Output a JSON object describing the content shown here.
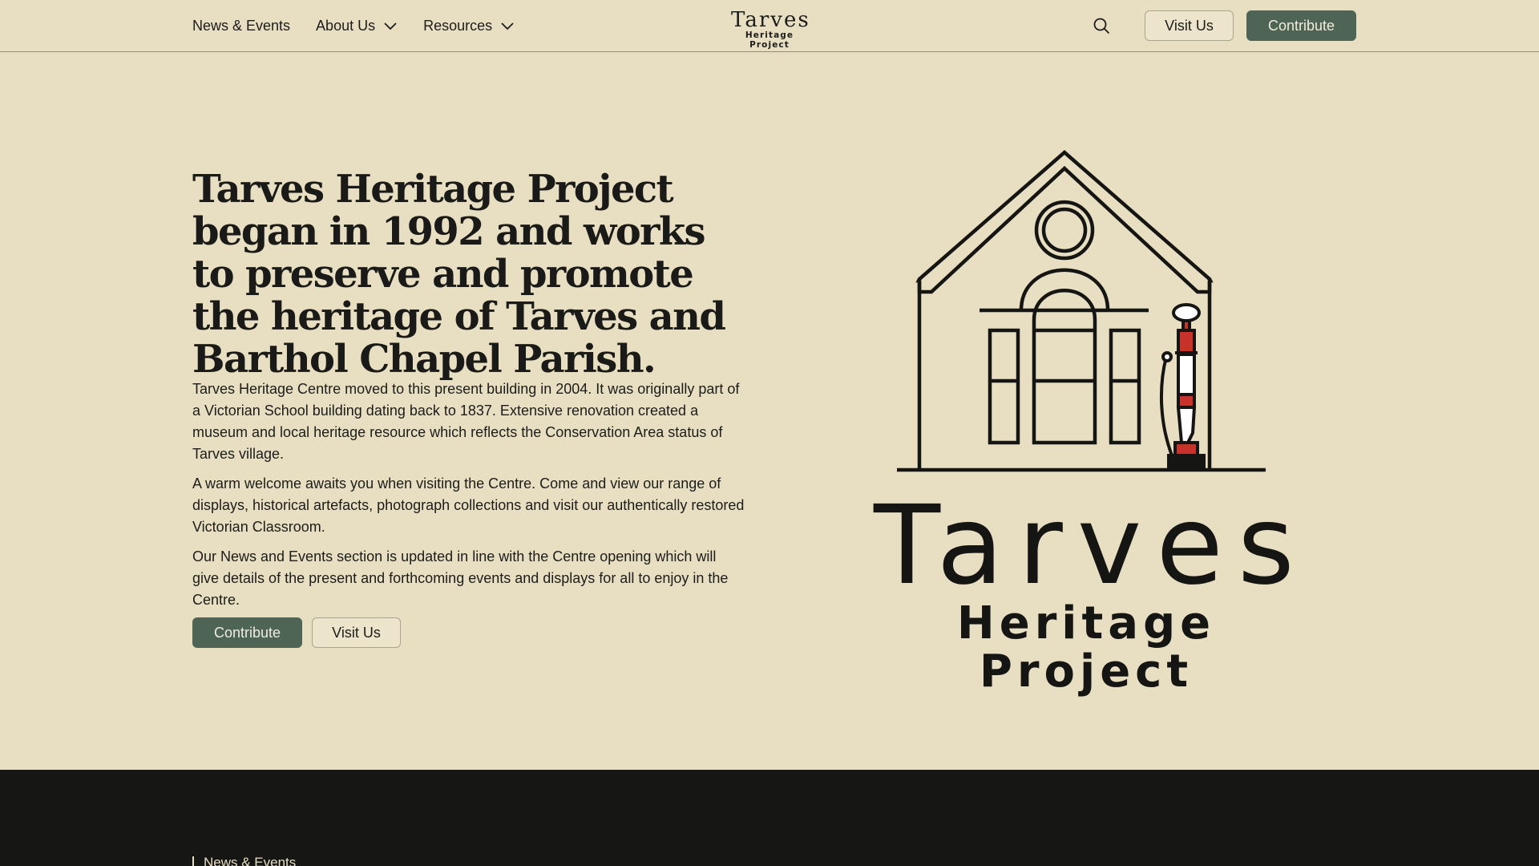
{
  "header": {
    "nav": [
      {
        "label": "News & Events",
        "has_dropdown": false
      },
      {
        "label": "About Us",
        "has_dropdown": true
      },
      {
        "label": "Resources",
        "has_dropdown": true
      }
    ],
    "logo": {
      "name": "Tarves",
      "subtitle": "Heritage Project"
    },
    "search_icon": "search-icon",
    "visit_label": "Visit Us",
    "contribute_label": "Contribute"
  },
  "hero": {
    "title": "Tarves Heritage Project began in 1992 and works to preserve and promote the heritage of Tarves and Barthol Chapel Parish.",
    "paragraphs": [
      "Tarves Heritage Centre moved to this present building in 2004.  It was  originally part of a Victorian School building dating back to 1837. Extensive renovation created a museum and local heritage resource which reflects the Conservation Area status of Tarves village.",
      "A warm welcome awaits you when visiting the Centre. Come and view our range of displays, historical artefacts, photograph collections and visit our authentically restored Victorian Classroom.",
      "Our News and Events section is updated in line with the Centre opening which will give details of the present and forthcoming events and displays for all to enjoy in the Centre."
    ],
    "primary_button": "Contribute",
    "secondary_button": "Visit Us",
    "logo_image": {
      "name": "Tarves",
      "subtitle": "Heritage Project",
      "icon": "school-building-with-water-pump"
    }
  },
  "footer": {
    "links": [
      "News & Events"
    ]
  },
  "colors": {
    "background": "#e8dfc3",
    "accent_green": "#4e6556",
    "footer_bg": "#161615",
    "pump_red": "#c8322a"
  }
}
